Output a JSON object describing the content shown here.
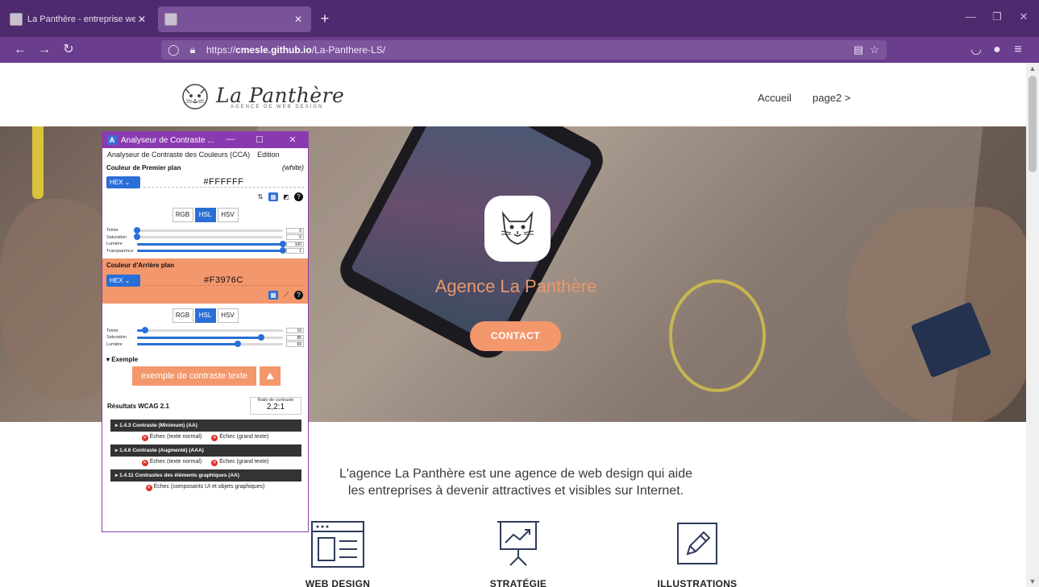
{
  "browser": {
    "tabs": [
      {
        "title": "La Panthère - entreprise web de"
      },
      {
        "title": ""
      }
    ],
    "url": {
      "host": "cmesle.github.io",
      "prefix": "https://",
      "path": "/La-Panthere-LS/"
    }
  },
  "site": {
    "logo_name": "La Panthère",
    "logo_sub": "AGENCE DE WEB DESIGN",
    "nav": [
      "Accueil",
      "page2 >"
    ],
    "hero_title": "Agence La Panthère",
    "contact_label": "CONTACT",
    "intro_line1": "L'agence La Panthère est une agence de web design qui aide",
    "intro_line2": "les entreprises à devenir attractives et visibles sur Internet.",
    "services": [
      "WEB DESIGN",
      "STRATÉGIE",
      "ILLUSTRATIONS"
    ]
  },
  "cca": {
    "title": "Analyseur de Contraste ...",
    "menu": [
      "Analyseur de Contraste des Couleurs (CCA)",
      "Edition"
    ],
    "foreground": {
      "heading": "Couleur de Premier plan",
      "name": "(white)",
      "format": "HEX",
      "hex": "#FFFFFF",
      "color": "#FFFFFF",
      "modes": [
        "RGB",
        "HSL",
        "HSV"
      ],
      "active_mode": "HSL",
      "sliders": [
        {
          "label": "Teinte",
          "value": "0",
          "frac": 0.0
        },
        {
          "label": "Saturation",
          "value": "0",
          "frac": 0.0
        },
        {
          "label": "Lumière",
          "value": "100",
          "frac": 1.0
        },
        {
          "label": "Transparence",
          "value": "1",
          "frac": 1.0
        }
      ]
    },
    "background": {
      "heading": "Couleur d'Arrière plan",
      "format": "HEX",
      "hex": "#F3976C",
      "color": "#F3976C",
      "modes": [
        "RGB",
        "HSL",
        "HSV"
      ],
      "active_mode": "HSL",
      "sliders": [
        {
          "label": "Teinte",
          "value": "19",
          "frac": 0.053
        },
        {
          "label": "Saturation",
          "value": "85",
          "frac": 0.85
        },
        {
          "label": "Lumière",
          "value": "69",
          "frac": 0.69
        }
      ]
    },
    "example_heading": "▾ Exemple",
    "example_text": "exemple de contraste texte",
    "results_title": "Résultats WCAG 2.1",
    "ratio_label": "Ratio de contraste",
    "ratio_value": "2,2:1",
    "criteria": [
      {
        "label": "▸ 1.4.3 Contraste (Minimum) (AA)",
        "results": [
          "Échec (texte normal)",
          "Échec (grand texte)"
        ]
      },
      {
        "label": "▸ 1.4.6 Contraste (Augmenté) (AAA)",
        "results": [
          "Échec (texte normal)",
          "Échec (grand texte)"
        ]
      },
      {
        "label": "▸ 1.4.11 Contrastes des éléments graphiques (AA)",
        "results": [
          "Échec (composants UI et objets graphiques)"
        ]
      }
    ]
  },
  "colors": {
    "accent": "#F3976C",
    "browser": "#4E2A6E",
    "cca_title": "#8A3AB0"
  }
}
